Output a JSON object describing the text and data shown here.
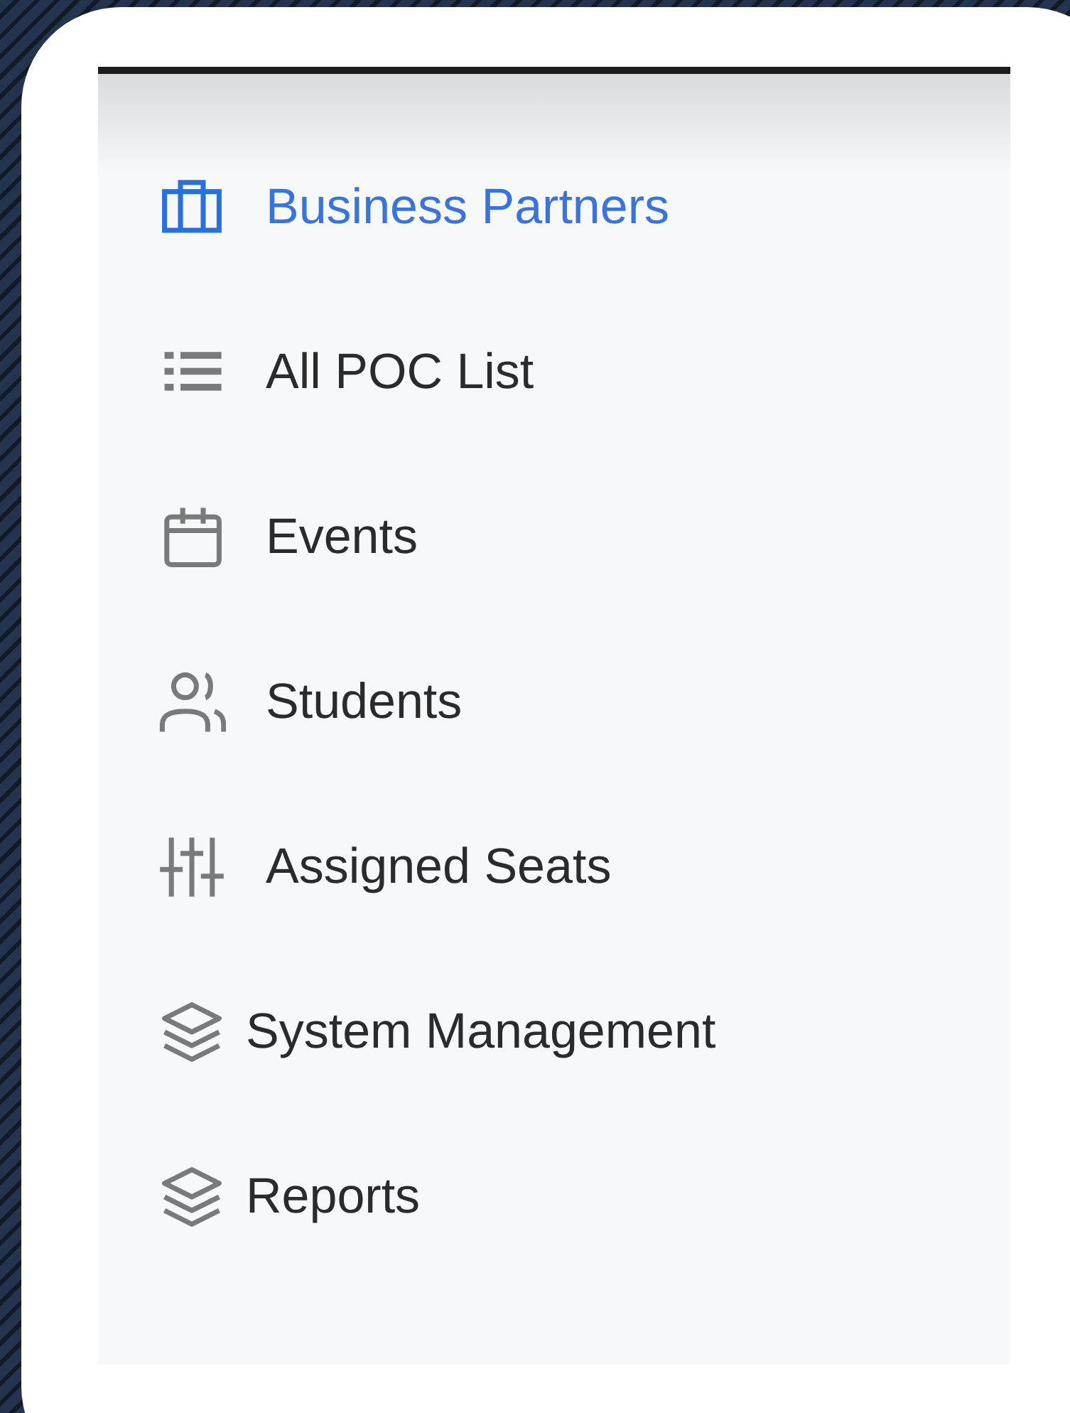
{
  "sidebar": {
    "items": [
      {
        "label": "Business Partners",
        "selected": true
      },
      {
        "label": "All POC List",
        "selected": false
      },
      {
        "label": "Events",
        "selected": false
      },
      {
        "label": "Students",
        "selected": false
      },
      {
        "label": "Assigned Seats",
        "selected": false
      },
      {
        "label": "System Management",
        "selected": false
      },
      {
        "label": "Reports",
        "selected": false
      }
    ]
  }
}
